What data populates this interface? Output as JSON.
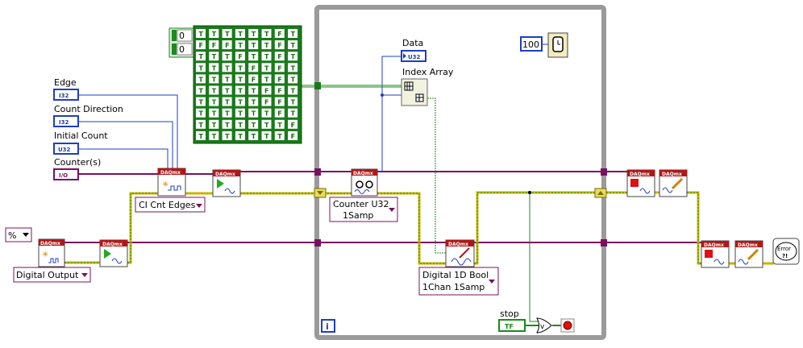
{
  "labels": {
    "edge": "Edge",
    "count_direction": "Count Direction",
    "initial_count": "Initial Count",
    "counters": "Counter(s)",
    "data": "Data",
    "index_array": "Index Array",
    "stop": "stop"
  },
  "constants": {
    "edge_type": "I32",
    "count_direction_type": "I32",
    "initial_count_type": "U32",
    "counters_type": "I/O",
    "data_type": "U32",
    "wait_ms": "100",
    "array_index_0": "0",
    "array_index_1": "0",
    "stop_type": "TF",
    "percent_symbol": "%",
    "error_text": "Error ?!"
  },
  "selectors": {
    "ci_cnt_edges": "CI Cnt Edges",
    "counter_u32_line1": "Counter U32",
    "counter_u32_line2": "1Samp",
    "digital_output": "Digital Output",
    "digital_bool_line1": "Digital 1D Bool",
    "digital_bool_line2": "1Chan 1Samp"
  },
  "daqmx_label": "DAQmx",
  "info_glyph": "i",
  "bool_array": [
    [
      "T",
      "T",
      "T",
      "T",
      "T",
      "T",
      "F",
      "T"
    ],
    [
      "F",
      "F",
      "F",
      "T",
      "T",
      "T",
      "F",
      "T"
    ],
    [
      "T",
      "T",
      "T",
      "F",
      "T",
      "T",
      "F",
      "T"
    ],
    [
      "T",
      "T",
      "T",
      "T",
      "F",
      "T",
      "F",
      "T"
    ],
    [
      "T",
      "T",
      "T",
      "T",
      "F",
      "T",
      "F",
      "T"
    ],
    [
      "T",
      "T",
      "T",
      "T",
      "T",
      "F",
      "F",
      "T"
    ],
    [
      "T",
      "T",
      "T",
      "T",
      "T",
      "F",
      "F",
      "T"
    ],
    [
      "T",
      "T",
      "T",
      "T",
      "T",
      "T",
      "F",
      "T"
    ],
    [
      "T",
      "T",
      "T",
      "T",
      "T",
      "T",
      "T",
      "F"
    ],
    [
      "T",
      "T",
      "T",
      "T",
      "T",
      "T",
      "T",
      "F"
    ]
  ],
  "colors": {
    "int_wire": "#1f3fbf",
    "task_wire": "#7a1060",
    "error_wire": "#c8b400",
    "bool_wire": "#1a8a1a",
    "daqmx_header": "#b01818",
    "loop_frame": "#9a9a9a"
  }
}
